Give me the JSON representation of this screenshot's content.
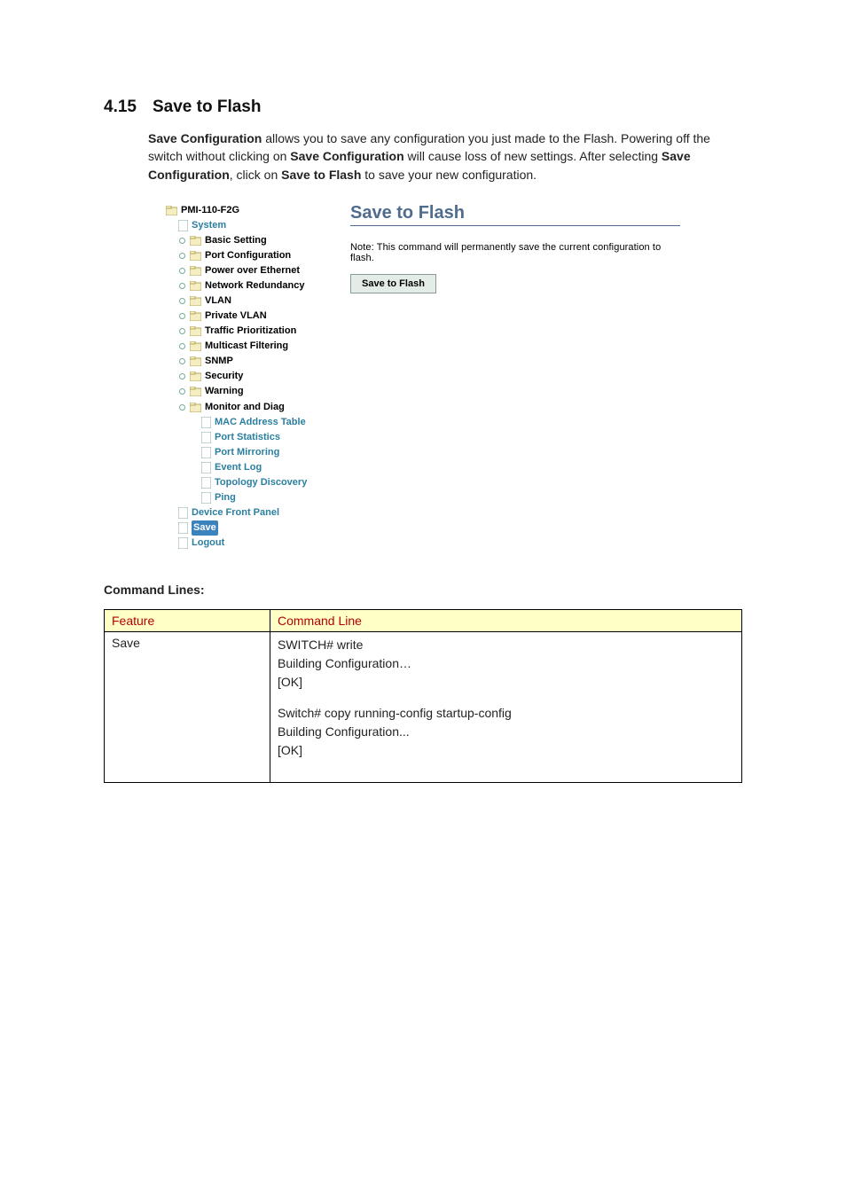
{
  "heading_number": "4.15",
  "heading_title": "Save to Flash",
  "intro_parts": {
    "b1": "Save Configuration",
    "t1": " allows you to save any configuration you just made to the Flash. Powering off the switch without clicking on ",
    "b2": "Save Configuration",
    "t2": " will cause loss of new settings. After selecting ",
    "b3": "Save Configuration",
    "t3": ", click on ",
    "b4": "Save to Flash",
    "t4": " to save your new configuration."
  },
  "tree": {
    "root": "PMI-110-F2G",
    "system": "System",
    "folders": [
      "Basic Setting",
      "Port Configuration",
      "Power over Ethernet",
      "Network Redundancy",
      "VLAN",
      "Private VLAN",
      "Traffic Prioritization",
      "Multicast Filtering",
      "SNMP",
      "Security",
      "Warning",
      "Monitor and Diag"
    ],
    "monitor_children": [
      "MAC Address Table",
      "Port Statistics",
      "Port Mirroring",
      "Event Log",
      "Topology Discovery",
      "Ping"
    ],
    "device_front_panel": "Device Front Panel",
    "save": "Save",
    "logout": "Logout"
  },
  "pane": {
    "title": "Save to Flash",
    "note": "Note: This command will permanently save the current configuration to flash.",
    "button": "Save to Flash"
  },
  "cmd_caption": "Command Lines:",
  "table": {
    "h_feature": "Feature",
    "h_cmd": "Command Line",
    "row_feature": "Save",
    "cl1": "SWITCH# write",
    "cl2": "Building Configuration…",
    "cl3": "[OK]",
    "cl4": "Switch# copy running-config startup-config",
    "cl5": "Building Configuration...",
    "cl6": "[OK]"
  }
}
